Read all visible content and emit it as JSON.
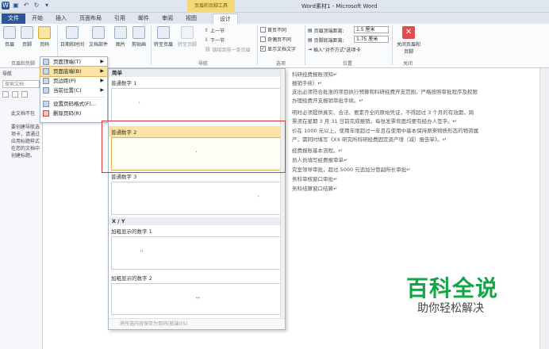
{
  "window": {
    "title": "Word素材1 - Microsoft Word",
    "context_tab": "页眉和页脚工具"
  },
  "tabs": [
    "文件",
    "开始",
    "插入",
    "页面布局",
    "引用",
    "邮件",
    "审阅",
    "视图",
    "设计"
  ],
  "ribbon": {
    "header": "页眉",
    "footer": "页脚",
    "page_number": "页码",
    "date_time": "日期和时间",
    "doc_parts": "文档部件",
    "picture": "图片",
    "clipart": "剪贴画",
    "goto_header": "转至页眉",
    "goto_footer": "转至页脚",
    "prev": "上一节",
    "next": "下一节",
    "link_prev": "链接到前一条页眉",
    "diff_first": "首页不同",
    "diff_odd_even": "奇偶页不同",
    "show_doc_text": "显示文档文字",
    "header_top_label": "页眉顶端距离:",
    "header_top_value": "1.5 厘米",
    "footer_bottom_label": "页脚底端距离:",
    "footer_bottom_value": "1.75 厘米",
    "insert_align_tab": "插入\"对齐方式\"选项卡",
    "close": "关闭页眉和页脚",
    "groups": {
      "hf": "页眉和页脚",
      "nav": "导航",
      "options": "选项",
      "position": "位置",
      "close": "关闭"
    }
  },
  "navpane": {
    "title": "导航",
    "search_placeholder": "搜索文档",
    "msg1": "此文档不包",
    "msg2": "要创建导航选项卡，请通过应用标题样式在您的文档中创建标题。"
  },
  "menu": {
    "items": [
      {
        "label": "页面顶端(T)",
        "has_sub": true
      },
      {
        "label": "页面底端(B)",
        "has_sub": true,
        "highlight": true
      },
      {
        "label": "页边距(P)",
        "has_sub": true
      },
      {
        "label": "当前位置(C)",
        "has_sub": true
      },
      {
        "label": "设置页码格式(F)...",
        "has_sub": false
      },
      {
        "label": "删除页码(R)",
        "has_sub": false
      }
    ]
  },
  "gallery": {
    "section1": "简单",
    "item1": "普通数字 1",
    "item2": "普通数字 2",
    "item3": "普通数字 3",
    "section2": "X / Y",
    "item4": "加粗显示的数字 1",
    "item5": "加粗显示的数字 2",
    "footer": "将所选内容保存为页码(底端)(S)"
  },
  "document": {
    "lines": [
      "科研经费报账须知↵",
      "报销手续）↵",
      "支出必须符合批准的项目执行预算和科研经费开支范围，严格按照审批程序及权限",
      "办理经费开支报销审批手续。↵",
      "明时必须提供真实、合法、要素齐全的原始凭证，不得超过 3 个月的有效期，跨",
      "票须在星期 3 月 31 日前完成报销，每张发票背面均要有经办人签字。↵",
      "价在 1000 元以上，使用年限超过一年且在使用中基本保持原来物质形态的物资属",
      "产，需同时填写《XX 研究所科研经费固定资产增（减）报告单》。↵",
      "经费报账基本流程。↵",
      "员人员填写经费报审单↵",
      "究室领导审批，超过 5000 元追加分管副所长审批↵",
      "务科审核窗口审批↵",
      "务科结算窗口结算↵"
    ]
  },
  "watermark": {
    "main": "百科全说",
    "sub": "助你轻松解决"
  }
}
